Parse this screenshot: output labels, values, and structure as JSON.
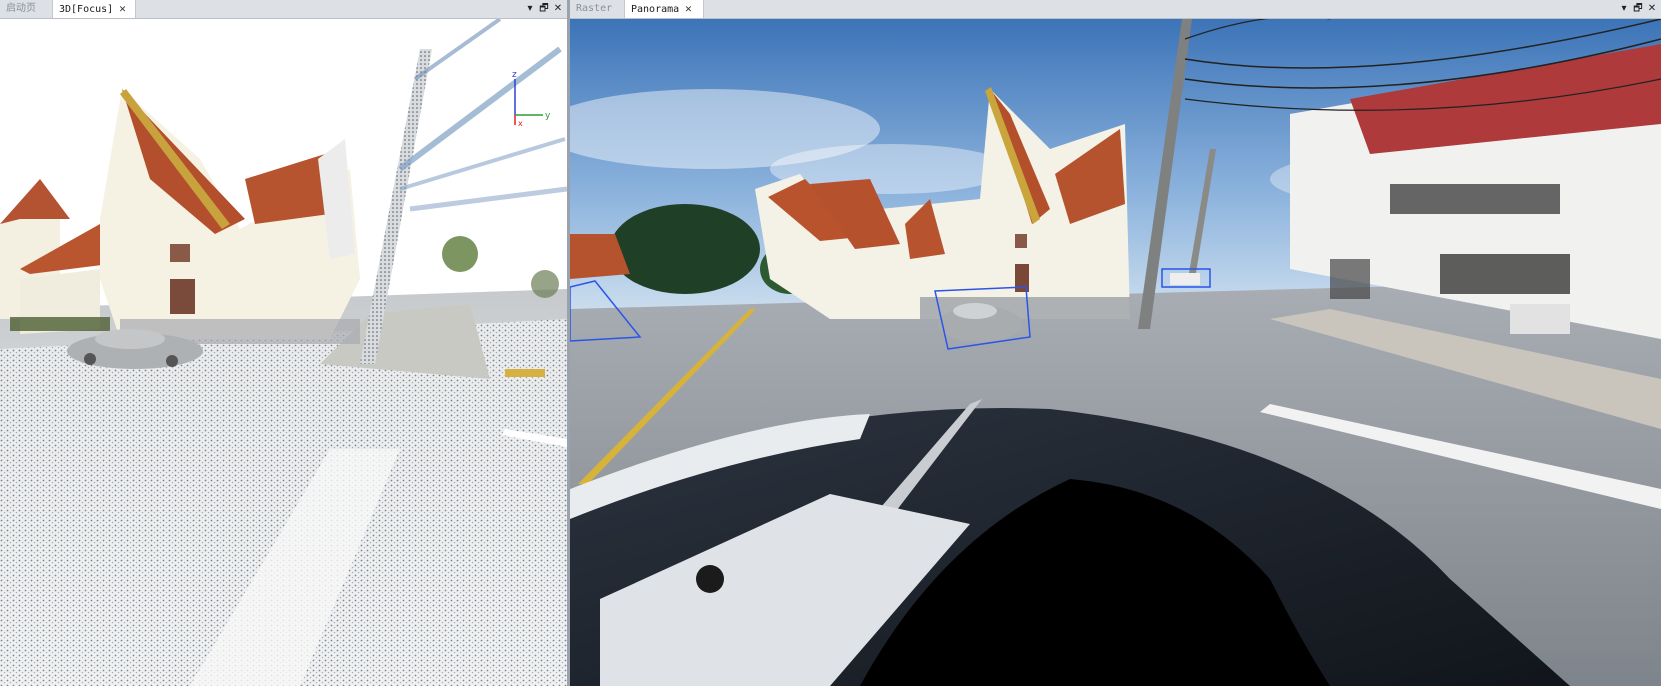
{
  "left_panel": {
    "tabs": [
      {
        "label": "启动页",
        "active": false
      },
      {
        "label": "3D[Focus]",
        "active": true,
        "close": "✕"
      }
    ],
    "controls": {
      "dropdown": "▾",
      "restore": "🗗",
      "close": "✕"
    },
    "axis_gizmo": {
      "z": "z",
      "y": "y",
      "x": "x"
    }
  },
  "right_panel": {
    "tabs": [
      {
        "label": "Raster",
        "active": false
      },
      {
        "label": "Panorama",
        "active": true,
        "close": "✕"
      }
    ],
    "controls": {
      "dropdown": "▾",
      "restore": "🗗",
      "close": "✕"
    }
  },
  "colors": {
    "sky": "#4f86c6",
    "roof": "#b5532e",
    "wall": "#f2efe4",
    "road": "#8f969f",
    "selection_box": "#2a55e8"
  }
}
